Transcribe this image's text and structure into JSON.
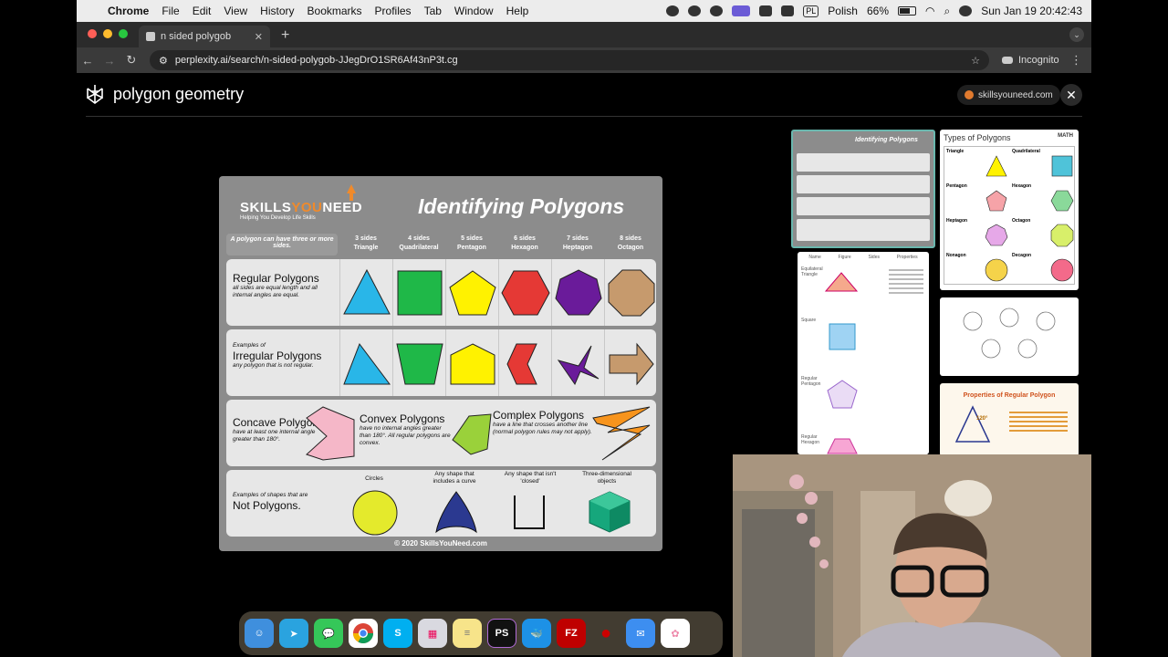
{
  "menubar": {
    "app_name": "Chrome",
    "menus": [
      "File",
      "Edit",
      "View",
      "History",
      "Bookmarks",
      "Profiles",
      "Tab",
      "Window",
      "Help"
    ],
    "input_source": "PL",
    "input_language": "Polish",
    "battery": "66%",
    "datetime": "Sun Jan 19  20:42:43"
  },
  "browser": {
    "tab_title": "n sided polygob",
    "url": "perplexity.ai/search/n-sided-polygob-JJegDrO1SR6Af43nP3t.cg",
    "incognito_label": "Incognito"
  },
  "page": {
    "title": "polygon geometry",
    "source": "skillsyouneed.com"
  },
  "infographic": {
    "brand_part1": "SKILLS",
    "brand_part2": "YOU",
    "brand_part3": "NEED",
    "tagline": "Helping You Develop Life Skills",
    "title": "Identifying Polygons",
    "note": "A polygon can have three or more sides.",
    "columns": [
      {
        "sides": "3 sides",
        "name": "Triangle"
      },
      {
        "sides": "4 sides",
        "name": "Quadrilateral"
      },
      {
        "sides": "5 sides",
        "name": "Pentagon"
      },
      {
        "sides": "6 sides",
        "name": "Hexagon"
      },
      {
        "sides": "7 sides",
        "name": "Heptagon"
      },
      {
        "sides": "8 sides",
        "name": "Octagon"
      }
    ],
    "regular": {
      "title": "Regular Polygons",
      "desc": "all sides are equal length and all internal angles are equal."
    },
    "irregular": {
      "prefix": "Examples of",
      "title": "Irregular Polygons",
      "desc": "any polygon that is not regular."
    },
    "concave": {
      "title": "Concave Polygons",
      "desc": "have at least one internal angle greater than 180°."
    },
    "convex": {
      "title": "Convex Polygons",
      "desc": "have no internal angles greater than 180°.  All regular polygons are convex."
    },
    "complex": {
      "title": "Complex Polygons",
      "desc": "have a line that crosses another line (normal polygon rules may not apply)."
    },
    "not_polygons": {
      "prefix": "Examples of  shapes that are",
      "title": "Not Polygons.",
      "labels": [
        "Circles",
        "Any shape that includes a curve",
        "Any shape that isn't 'closed'",
        "Three-dimensional objects"
      ]
    },
    "footer": "© 2020 SkillsYouNeed.com"
  },
  "thumbnails": {
    "t1_title": "Identifying Polygons",
    "t2_title": "Types of Polygons",
    "t2_badge": "MATH",
    "t2_items": [
      "Triangle",
      "Quadrilateral",
      "Pentagon",
      "Hexagon",
      "Heptagon",
      "Octagon",
      "Nonagon",
      "Decagon"
    ],
    "t3_headers": [
      "Name",
      "Figure",
      "Sides",
      "Properties"
    ],
    "t3_rows": [
      "Equilateral Triangle",
      "Square",
      "Regular Pentagon",
      "Regular Hexagon"
    ],
    "t5_title": "Properties of Regular Polygon",
    "t5_angle": "120°"
  },
  "dock": [
    "Finder",
    "Telegram",
    "Messages",
    "Chrome",
    "Skype",
    "Launchpad",
    "Notes",
    "PS",
    "Docker",
    "FZ",
    "Cherry",
    "Mail",
    "Photos"
  ],
  "colors": {
    "cyan": "#29b6e8",
    "green": "#1fb848",
    "yellow": "#fff200",
    "red": "#e53935",
    "purple": "#6a1b9a",
    "tan": "#c69a6d",
    "pink": "#f5b7c8",
    "lime": "#9ad13a",
    "orange": "#f7941d",
    "teal": "#16a77c",
    "navy": "#2b3990",
    "circle_yellow": "#e4ea2c"
  }
}
